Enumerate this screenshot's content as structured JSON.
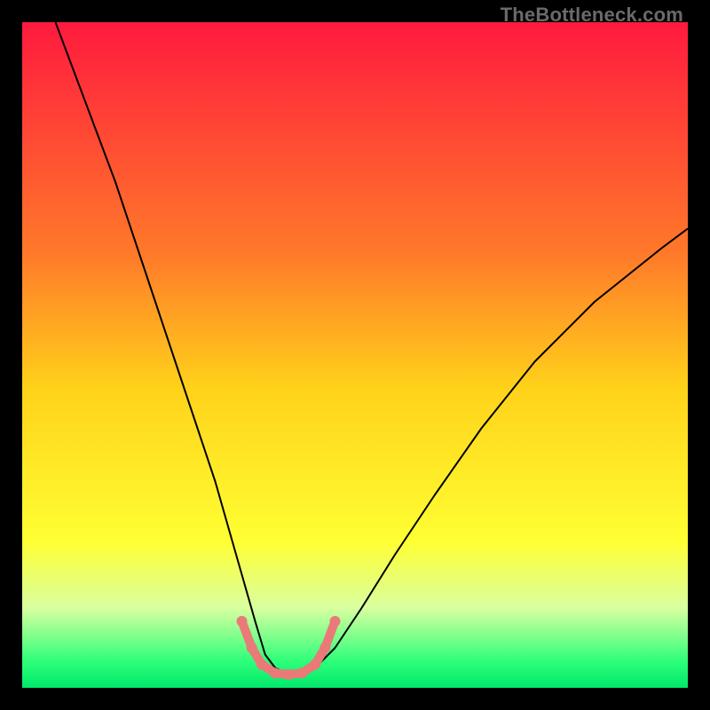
{
  "watermark": {
    "text": "TheBottleneck.com"
  },
  "chart_data": {
    "type": "line",
    "title": "",
    "xlabel": "",
    "ylabel": "",
    "xlim": [
      0,
      100
    ],
    "ylim": [
      0,
      100
    ],
    "grid": false,
    "legend": false,
    "background_gradient": {
      "orientation": "vertical",
      "stops": [
        {
          "pos": 0.0,
          "color": "#ff1a3e"
        },
        {
          "pos": 0.35,
          "color": "#ff7a2a"
        },
        {
          "pos": 0.55,
          "color": "#ffd21a"
        },
        {
          "pos": 0.78,
          "color": "#ffff33"
        },
        {
          "pos": 0.88,
          "color": "#d9ffa0"
        },
        {
          "pos": 0.96,
          "color": "#2eff7a"
        },
        {
          "pos": 1.0,
          "color": "#00e86b"
        }
      ]
    },
    "series": [
      {
        "name": "bottleneck-curve",
        "color": "#000000",
        "stroke_width": 2,
        "x": [
          5,
          8,
          11,
          14,
          17,
          20,
          23,
          26,
          29,
          31,
          33,
          35,
          36.5,
          38,
          40,
          42,
          44,
          47,
          51,
          56,
          62,
          69,
          77,
          86,
          96,
          100
        ],
        "y": [
          100,
          92,
          84,
          76,
          67,
          58,
          49,
          40,
          31,
          24,
          17,
          10,
          5,
          3,
          2,
          2,
          3,
          6,
          12,
          20,
          29,
          39,
          49,
          58,
          66,
          69
        ]
      },
      {
        "name": "optimal-band-marker",
        "color": "#e97a78",
        "stroke_width": 10,
        "linecap": "round",
        "x": [
          33,
          34.5,
          36,
          38,
          40,
          42,
          44,
          45.5,
          47
        ],
        "y": [
          10,
          6,
          3.5,
          2.2,
          2,
          2.2,
          3.5,
          6,
          10
        ],
        "dots_x": [
          33,
          34.5,
          36,
          38,
          40,
          42,
          44,
          45.5,
          47
        ],
        "dots_y": [
          10,
          6,
          3.5,
          2.2,
          2,
          2.2,
          3.5,
          6,
          10
        ],
        "dot_radius": 6
      }
    ]
  }
}
